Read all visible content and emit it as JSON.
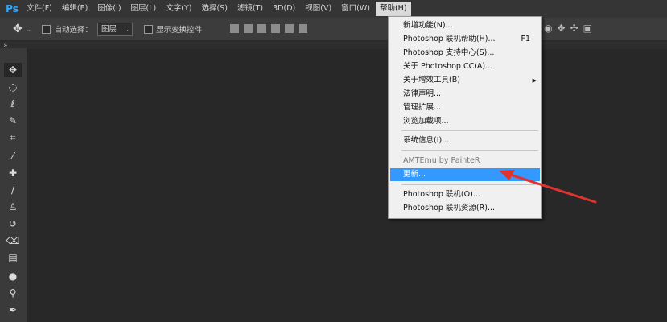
{
  "app": {
    "logo": "Ps"
  },
  "menubar": {
    "items": [
      "文件(F)",
      "编辑(E)",
      "图像(I)",
      "图层(L)",
      "文字(Y)",
      "选择(S)",
      "滤镜(T)",
      "3D(D)",
      "视图(V)",
      "窗口(W)",
      "帮助(H)"
    ]
  },
  "options": {
    "auto_select_label": "自动选择：",
    "auto_select_value": "图层",
    "show_transform_label": "显示变换控件"
  },
  "help_menu": {
    "items": [
      {
        "label": "新增功能(N)..."
      },
      {
        "label": "Photoshop 联机帮助(H)...",
        "shortcut": "F1"
      },
      {
        "label": "Photoshop 支持中心(S)..."
      },
      {
        "label": "关于 Photoshop CC(A)..."
      },
      {
        "label": "关于增效工具(B)"
      },
      {
        "label": "法律声明..."
      },
      {
        "label": "管理扩展..."
      },
      {
        "label": "浏览加载项..."
      },
      {
        "label": "系统信息(I)..."
      },
      {
        "label": "AMTEmu by PainteR"
      },
      {
        "label": "更新..."
      },
      {
        "label": "Photoshop 联机(O)..."
      },
      {
        "label": "Photoshop 联机资源(R)..."
      }
    ]
  },
  "colors": {
    "highlight": "#3399ff",
    "annotation_arrow": "#e0322f",
    "canvas": "#282828"
  }
}
